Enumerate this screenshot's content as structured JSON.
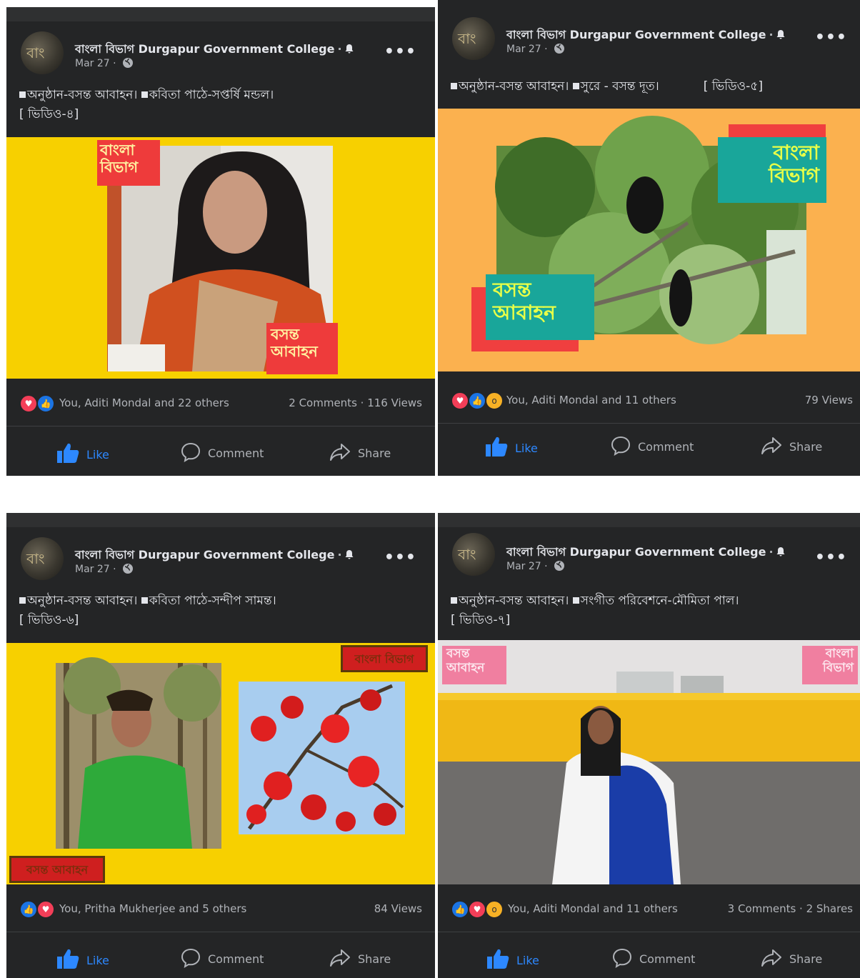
{
  "colors": {
    "card_bg": "#242526",
    "text": "#e4e6eb",
    "muted": "#b0b3b8",
    "like_blue": "#2d88ff"
  },
  "posts": [
    {
      "page_name": "বাংলা বিভাগ Durgapur Government College",
      "date": "Mar 27",
      "caption_line1": "অনুষ্ঠান-বসন্ত আবাহন। ",
      "caption_line1b": "কবিতা পাঠে-সপ্তর্ষি মন্ডল।",
      "caption_line2": "[ ভিডিও-৪]",
      "reaction_icons": [
        "love-icon",
        "like-icon"
      ],
      "reactors": "You, Aditi Mondal and 22 others",
      "stats_right": "2 Comments · 116 Views",
      "badge_top": "বাংলা\nবিভাগ",
      "badge_bottom": "বসন্ত\nআবাহন",
      "actions": {
        "like": "Like",
        "comment": "Comment",
        "share": "Share"
      }
    },
    {
      "page_name": "বাংলা বিভাগ Durgapur Government College",
      "date": "Mar 27",
      "caption_line1": "অনুষ্ঠান-বসন্ত আবাহন। ",
      "caption_line1b": "সুরে - বসন্ত দূত।",
      "caption_line2": "[ ভিডিও-৫]",
      "reaction_icons": [
        "love-icon",
        "like-icon",
        "wow-icon"
      ],
      "reactors": "You, Aditi Mondal and 11 others",
      "stats_right": "79 Views",
      "badge_top": "বাংলা\nবিভাগ",
      "badge_bottom": "বসন্ত\nআবাহন",
      "actions": {
        "like": "Like",
        "comment": "Comment",
        "share": "Share"
      }
    },
    {
      "page_name": "বাংলা বিভাগ Durgapur Government College",
      "date": "Mar 27",
      "caption_line1": "অনুষ্ঠান-বসন্ত আবাহন। ",
      "caption_line1b": "কবিতা পাঠে-সন্দীপ সামন্ত।",
      "caption_line2": "[ ভিডিও-৬]",
      "reaction_icons": [
        "like-icon",
        "love-icon"
      ],
      "reactors": "You, Pritha Mukherjee and 5 others",
      "stats_right": "84 Views",
      "badge_top": "বাংলা বিভাগ",
      "badge_bottom": "বসন্ত আবাহন",
      "actions": {
        "like": "Like",
        "comment": "Comment",
        "share": "Share"
      }
    },
    {
      "page_name": "বাংলা বিভাগ Durgapur Government College",
      "date": "Mar 27",
      "caption_line1": "অনুষ্ঠান-বসন্ত আবাহন। ",
      "caption_line1b": "সংগীত পরিবেশনে-মৌমিতা পাল।",
      "caption_line2": "[ ভিডিও-৭]",
      "reaction_icons": [
        "like-icon",
        "love-icon",
        "wow-icon"
      ],
      "reactors": "You, Aditi Mondal and 11 others",
      "stats_right": "3 Comments · 2 Shares",
      "badge_top": "বাংলা\nবিভাগ",
      "badge_bottom": "বসন্ত\nআবাহন",
      "actions": {
        "like": "Like",
        "comment": "Comment",
        "share": "Share"
      }
    }
  ]
}
